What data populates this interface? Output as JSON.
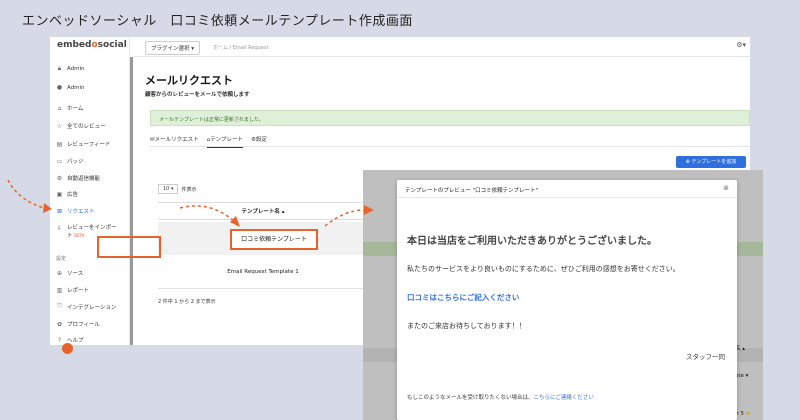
{
  "caption": "エンベッドソーシャル　口コミ依頼メールテンプレート作成画面",
  "colors": {
    "accent": "#e8632b",
    "brand_blue": "#2f6fde",
    "success_bg": "#dff0d8"
  },
  "logo": {
    "prefix": "embed",
    "o": "o",
    "suffix": "social"
  },
  "sidebar": {
    "items": [
      {
        "label": "Admin",
        "icon": "lock-icon"
      },
      {
        "label": "Admin",
        "icon": "user-icon"
      },
      {
        "label": "ホーム",
        "icon": "home-icon"
      },
      {
        "label": "全てのレビュー",
        "icon": "star-icon"
      },
      {
        "label": "レビューフィード",
        "icon": "feed-icon"
      },
      {
        "label": "バッジ",
        "icon": "badge-icon"
      },
      {
        "label": "自動返信機能",
        "icon": "auto-reply-icon"
      },
      {
        "label": "広告",
        "icon": "ad-icon"
      },
      {
        "label": "リクエスト",
        "icon": "request-icon"
      },
      {
        "label": "レビューをインポート",
        "icon": "import-icon",
        "badge": "BETA"
      }
    ],
    "section_label": "設定",
    "settings_items": [
      {
        "label": "ソース",
        "icon": "source-icon"
      },
      {
        "label": "レポート",
        "icon": "report-icon"
      },
      {
        "label": "インテグレーション",
        "icon": "integration-icon"
      },
      {
        "label": "プロフィール",
        "icon": "profile-icon"
      },
      {
        "label": "ヘルプ",
        "icon": "help-icon"
      }
    ]
  },
  "topbar": {
    "plugin_label": "プラグイン選択 ▾",
    "breadcrumb": "ホーム / Email Request"
  },
  "main": {
    "title": "メールリクエスト",
    "subtitle": "顧客からのレビューをメールで依頼します",
    "alert": "メールテンプレートは正常に更新されました。",
    "tabs": [
      {
        "label": "メールリクエスト",
        "icon": "mail-icon"
      },
      {
        "label": "テンプレート",
        "icon": "template-icon",
        "active": true
      },
      {
        "label": "設定",
        "icon": "settings-icon"
      }
    ],
    "add_button": "テンプレートを追加",
    "per_page_value": "10",
    "per_page_label": "件表示",
    "column_header": "テンプレート名 ▴",
    "rows": [
      "口コミ依頼テンプレート",
      "Email Request Template 1"
    ],
    "pagination": "2 件中 1 から 2 まで表示"
  },
  "modal": {
    "title": "テンプレートのプレビュー \"口コミ依頼テンプレート\"",
    "heading": "本日は当店をご利用いただきありがとうございました。",
    "p1": "私たちのサービスをより良いものにするために、ぜひご利用の感想をお寄せください。",
    "link": "口コミはこちらにご記入ください",
    "p2": "またのご来店お待ちしております！！",
    "sign": "スタッフ一同",
    "footer_text": "もしこのようなメールを受け取りたくない場合は、",
    "footer_link": "こちらにご連絡ください"
  },
  "overlay": {
    "right_texts": [
      "名 ▴",
      "ate ▾",
      "ir 5"
    ]
  }
}
